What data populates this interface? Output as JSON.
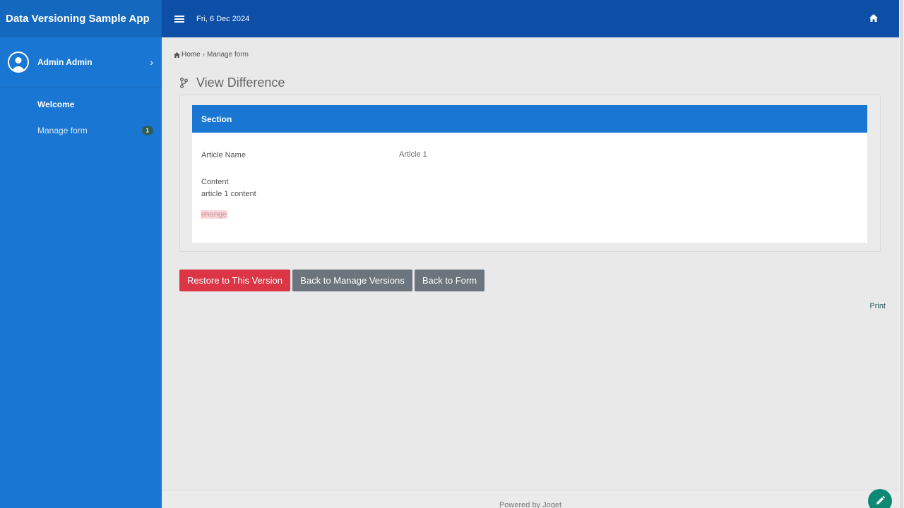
{
  "app": {
    "title": "Data Versioning Sample App"
  },
  "topbar": {
    "date": "Fri, 6 Dec 2024"
  },
  "sidebar": {
    "user": {
      "name": "Admin Admin"
    },
    "items": [
      {
        "label": "Welcome"
      },
      {
        "label": "Manage form",
        "badge": "1"
      }
    ]
  },
  "breadcrumb": {
    "home": "Home",
    "separator": "›",
    "current": "Manage form"
  },
  "page": {
    "title": "View Difference"
  },
  "section": {
    "title": "Section",
    "fields": [
      {
        "label": "Article Name",
        "value": "Article 1"
      },
      {
        "label": "Content",
        "value": "article 1 content",
        "change": "change"
      }
    ]
  },
  "buttons": {
    "restore": "Restore to This Version",
    "back_versions": "Back to Manage Versions",
    "back_form": "Back to Form"
  },
  "print": "Print",
  "footer": {
    "text": "Powered by Joget"
  },
  "colors": {
    "sidebar": "#1976d2",
    "topbar": "#0d4ea6",
    "danger": "#dc3545",
    "secondary": "#6c757d",
    "fab": "#0e8a74"
  }
}
